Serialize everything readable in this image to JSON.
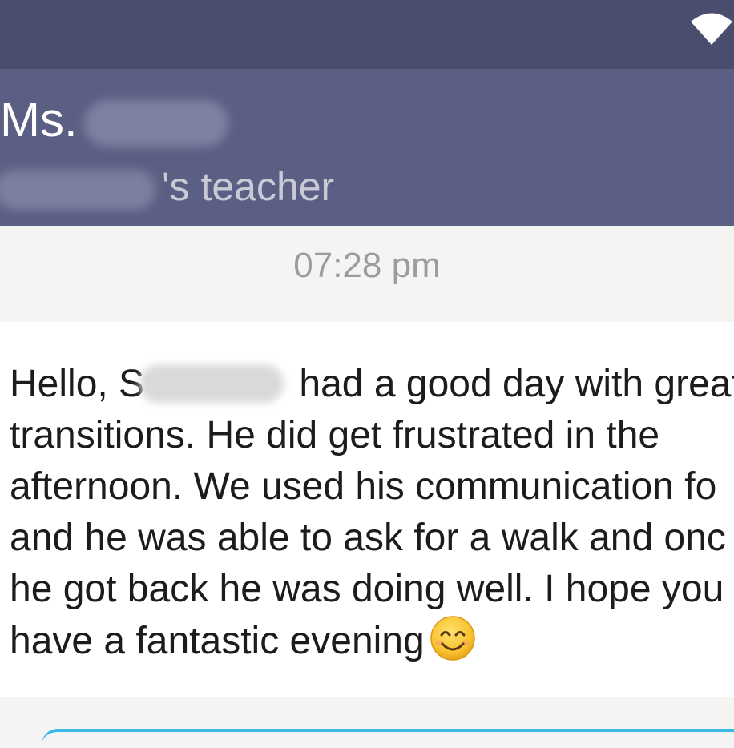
{
  "status_bar": {
    "wifi_icon": "wifi-icon"
  },
  "header": {
    "title_prefix": "Ms.",
    "subtitle_suffix": "'s teacher"
  },
  "conversation": {
    "timestamp": "07:28 pm",
    "message": {
      "lines": [
        {
          "before": "Hello, S",
          "after": " had a good day with great"
        },
        {
          "text": "transitions. He did get frustrated in the"
        },
        {
          "text": "afternoon. We used his communication fo"
        },
        {
          "text": "and he was able to ask for a walk and onc"
        },
        {
          "text": "he got back he was doing well. I hope you"
        },
        {
          "text": "have a fantastic evening"
        }
      ],
      "emoji": "smiling-face-icon"
    }
  },
  "colors": {
    "status_bar": "#4b4d6e",
    "header": "#5c5f84",
    "accent": "#39b8e6"
  }
}
